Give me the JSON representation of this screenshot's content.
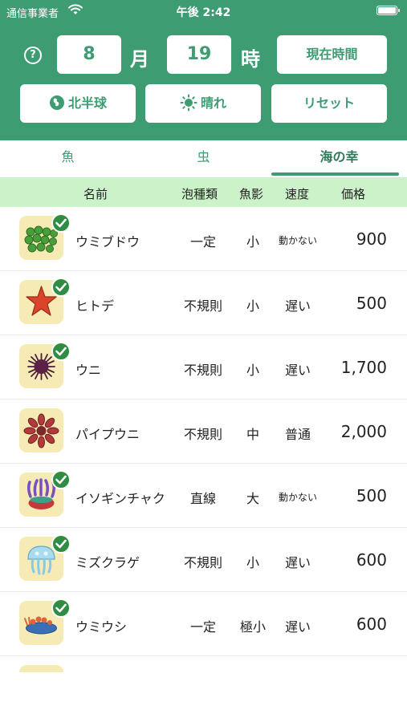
{
  "status_bar": {
    "carrier": "通信事業者",
    "time": "午後 2:42"
  },
  "controls": {
    "help_label": "?",
    "month_value": "8",
    "month_unit": "月",
    "hour_value": "19",
    "hour_unit": "時",
    "now_button": "現在時間",
    "hemisphere_button": "北半球",
    "weather_button": "晴れ",
    "reset_button": "リセット"
  },
  "tabs": [
    {
      "label": "魚",
      "selected": false
    },
    {
      "label": "虫",
      "selected": false
    },
    {
      "label": "海の幸",
      "selected": true
    }
  ],
  "columns": {
    "name": "名前",
    "bubble": "泡種類",
    "shadow": "魚影",
    "speed": "速度",
    "price": "価格"
  },
  "items": [
    {
      "name": "ウミブドウ",
      "bubble": "一定",
      "shadow": "小",
      "speed": "動かない",
      "price": "900",
      "caught": true,
      "icon": "sea-grapes-icon"
    },
    {
      "name": "ヒトデ",
      "bubble": "不規則",
      "shadow": "小",
      "speed": "遅い",
      "price": "500",
      "caught": true,
      "icon": "starfish-icon"
    },
    {
      "name": "ウニ",
      "bubble": "不規則",
      "shadow": "小",
      "speed": "遅い",
      "price": "1,700",
      "caught": true,
      "icon": "sea-urchin-icon"
    },
    {
      "name": "パイプウニ",
      "bubble": "不規則",
      "shadow": "中",
      "speed": "普通",
      "price": "2,000",
      "caught": false,
      "icon": "slate-pencil-urchin-icon"
    },
    {
      "name": "イソギンチャク",
      "bubble": "直線",
      "shadow": "大",
      "speed": "動かない",
      "price": "500",
      "caught": true,
      "icon": "sea-anemone-icon"
    },
    {
      "name": "ミズクラゲ",
      "bubble": "不規則",
      "shadow": "小",
      "speed": "遅い",
      "price": "600",
      "caught": true,
      "icon": "moon-jellyfish-icon"
    },
    {
      "name": "ウミウシ",
      "bubble": "一定",
      "shadow": "極小",
      "speed": "遅い",
      "price": "600",
      "caught": true,
      "icon": "sea-slug-icon"
    }
  ],
  "colors": {
    "header_green": "#3d9c72",
    "column_header": "#ccf2c9",
    "thumb_bg": "#f6ebb4",
    "check_green": "#2e8c43"
  }
}
